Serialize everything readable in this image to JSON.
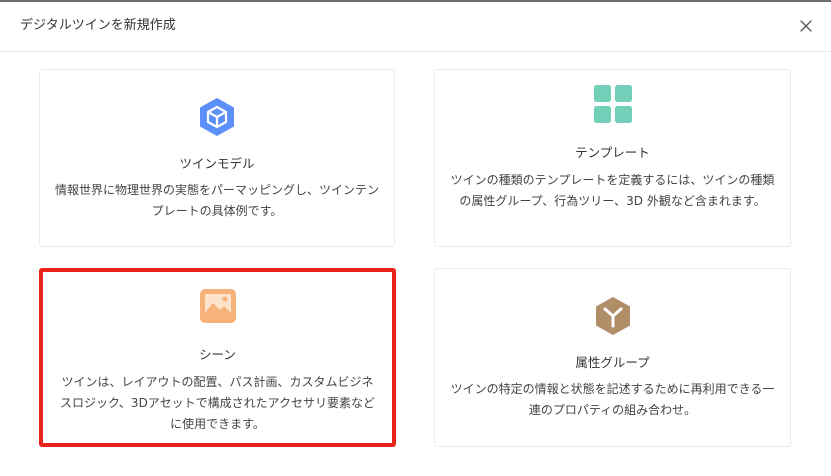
{
  "dialog": {
    "title": "デジタルツインを新規作成",
    "close_icon": "close-icon"
  },
  "cards": [
    {
      "key": "twin-model",
      "icon": "hexagon-cube-icon",
      "icon_color": "#5b8ff9",
      "title": "ツインモデル",
      "description": "情報世界に物理世界の実態をパーマッピングし、ツインテンプレートの具体例です。",
      "selected": false
    },
    {
      "key": "template",
      "icon": "grid-blocks-icon",
      "icon_color": "#73cfb7",
      "title": "テンプレート",
      "description": "ツインの種類のテンプレートを定義するには、ツインの種類の属性グループ、行為ツリー、3D 外観など含まれます。",
      "selected": false
    },
    {
      "key": "scene",
      "icon": "image-icon",
      "icon_color": "#f7b27a",
      "title": "シーン",
      "description": "ツインは、レイアウトの配置、パス計画、カスタムビジネスロジック、3Dアセットで構成されたアクセサリ要素などに使用できます。",
      "selected": true
    },
    {
      "key": "attribute-group",
      "icon": "hexagon-y-icon",
      "icon_color": "#b08f68",
      "title": "属性グループ",
      "description": "ツインの特定の情報と状態を記述するために再利用できる一連のプロパティの組み合わせ。",
      "selected": false
    }
  ],
  "selection_color": "#e8231e"
}
